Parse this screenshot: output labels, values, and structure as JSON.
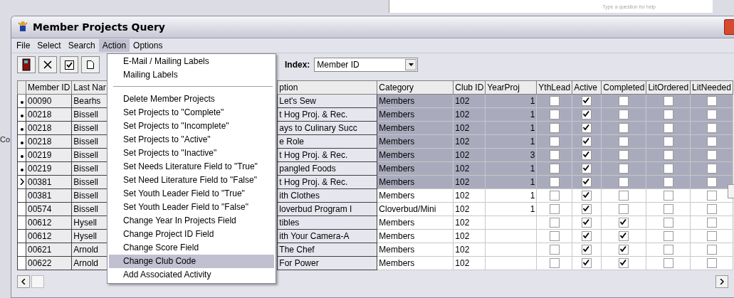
{
  "background": {
    "help_box": "Type a question for help",
    "fragment": "Co"
  },
  "window": {
    "title": "Member Projects Query"
  },
  "menu_bar": [
    {
      "label": "File",
      "selected": false
    },
    {
      "label": "Select",
      "selected": false
    },
    {
      "label": "Search",
      "selected": false
    },
    {
      "label": "Action",
      "selected": true
    },
    {
      "label": "Options",
      "selected": false
    }
  ],
  "action_menu": [
    {
      "kind": "item",
      "label": "E-Mail / Mailing Labels",
      "selected": false
    },
    {
      "kind": "item",
      "label": "Mailing Labels",
      "selected": false
    },
    {
      "kind": "separator"
    },
    {
      "kind": "item",
      "label": "Delete Member Projects",
      "selected": false
    },
    {
      "kind": "item",
      "label": "Set Projects to \"Complete\"",
      "selected": false
    },
    {
      "kind": "item",
      "label": "Set Projects to \"Incomplete\"",
      "selected": false
    },
    {
      "kind": "item",
      "label": "Set Projects to \"Active\"",
      "selected": false
    },
    {
      "kind": "item",
      "label": "Set Projects to \"Inactive\"",
      "selected": false
    },
    {
      "kind": "item",
      "label": "Set Needs Literature Field to \"True\"",
      "selected": false
    },
    {
      "kind": "item",
      "label": "Set Need Literature Field to \"False\"",
      "selected": false
    },
    {
      "kind": "item",
      "label": "Set Youth Leader Field to \"True\"",
      "selected": false
    },
    {
      "kind": "item",
      "label": "Set Youth Leader Field to \"False\"",
      "selected": false
    },
    {
      "kind": "item",
      "label": "Change Year In Projects Field",
      "selected": false
    },
    {
      "kind": "item",
      "label": "Change Project ID Field",
      "selected": false
    },
    {
      "kind": "item",
      "label": "Change Score Field",
      "selected": false
    },
    {
      "kind": "item",
      "label": "Change Club Code",
      "selected": true
    },
    {
      "kind": "item",
      "label": "Add Associated Activity",
      "selected": false
    }
  ],
  "toolbar": {
    "index_label": "Index:",
    "index_value": "Member ID"
  },
  "table": {
    "columns": [
      "Member ID",
      "Last Nar",
      "ption",
      "Category",
      "Club ID",
      "YearProj",
      "YthLead",
      "Active",
      "Completed",
      "LitOrdered",
      "LitNeeded"
    ],
    "rows": [
      {
        "kind": "dot",
        "selected": true,
        "member_id": "00090",
        "last_name": "Bearhs",
        "description": "Let's Sew",
        "category": "Members",
        "club_id": "102",
        "year_proj": "1",
        "yth_lead": false,
        "active": true,
        "completed": false,
        "lit_ordered": false,
        "lit_needed": false
      },
      {
        "kind": "dot",
        "selected": true,
        "member_id": "00218",
        "last_name": "Bissell",
        "description": "t Hog Proj. & Rec.",
        "category": "Members",
        "club_id": "102",
        "year_proj": "1",
        "yth_lead": false,
        "active": true,
        "completed": false,
        "lit_ordered": false,
        "lit_needed": false
      },
      {
        "kind": "dot",
        "selected": true,
        "member_id": "00218",
        "last_name": "Bissell",
        "description": "ays to Culinary Succ",
        "category": "Members",
        "club_id": "102",
        "year_proj": "1",
        "yth_lead": false,
        "active": true,
        "completed": false,
        "lit_ordered": false,
        "lit_needed": false
      },
      {
        "kind": "dot",
        "selected": true,
        "member_id": "00218",
        "last_name": "Bissell",
        "description": "e Role",
        "category": "Members",
        "club_id": "102",
        "year_proj": "1",
        "yth_lead": false,
        "active": true,
        "completed": false,
        "lit_ordered": false,
        "lit_needed": false
      },
      {
        "kind": "dot",
        "selected": true,
        "member_id": "00219",
        "last_name": "Bissell",
        "description": "t Hog Proj. & Rec.",
        "category": "Members",
        "club_id": "102",
        "year_proj": "3",
        "yth_lead": false,
        "active": true,
        "completed": false,
        "lit_ordered": false,
        "lit_needed": false
      },
      {
        "kind": "dot",
        "selected": true,
        "member_id": "00219",
        "last_name": "Bissell",
        "description": "pangled Foods",
        "category": "Members",
        "club_id": "102",
        "year_proj": "1",
        "yth_lead": false,
        "active": true,
        "completed": false,
        "lit_ordered": false,
        "lit_needed": false
      },
      {
        "kind": "pointer",
        "selected": true,
        "member_id": "00381",
        "last_name": "Bissell",
        "description": "t Hog Proj. & Rec.",
        "category": "Members",
        "club_id": "102",
        "year_proj": "1",
        "yth_lead": false,
        "active": true,
        "completed": false,
        "lit_ordered": false,
        "lit_needed": false
      },
      {
        "kind": "none",
        "selected": false,
        "member_id": "00381",
        "last_name": "Bissell",
        "description": "ith Clothes",
        "category": "Members",
        "club_id": "102",
        "year_proj": "1",
        "yth_lead": false,
        "active": true,
        "completed": false,
        "lit_ordered": false,
        "lit_needed": false
      },
      {
        "kind": "none",
        "selected": false,
        "member_id": "00574",
        "last_name": "Bissell",
        "description": "loverbud Program I",
        "category": "Cloverbud/Mini",
        "club_id": "102",
        "year_proj": "1",
        "yth_lead": false,
        "active": true,
        "completed": false,
        "lit_ordered": false,
        "lit_needed": false
      },
      {
        "kind": "none",
        "selected": false,
        "member_id": "00612",
        "last_name": "Hysell",
        "description": "tibles",
        "category": "Members",
        "club_id": "102",
        "yth_lead": false,
        "active": true,
        "completed": true,
        "lit_ordered": false,
        "lit_needed": false
      },
      {
        "kind": "none",
        "selected": false,
        "member_id": "00612",
        "last_name": "Hysell",
        "description": "ith Your Camera-A",
        "category": "Members",
        "club_id": "102",
        "yth_lead": false,
        "active": true,
        "completed": true,
        "lit_ordered": false,
        "lit_needed": false
      },
      {
        "kind": "none",
        "selected": false,
        "member_id": "00621",
        "last_name": "Arnold",
        "description": "The Chef",
        "category": "Members",
        "club_id": "102",
        "yth_lead": false,
        "active": true,
        "completed": true,
        "lit_ordered": false,
        "lit_needed": false
      },
      {
        "kind": "none",
        "selected": false,
        "member_id": "00622",
        "last_name": "Arnold",
        "description": "For Power",
        "category": "Members",
        "club_id": "102",
        "yth_lead": false,
        "active": true,
        "completed": true,
        "lit_ordered": false,
        "lit_needed": false
      }
    ]
  }
}
